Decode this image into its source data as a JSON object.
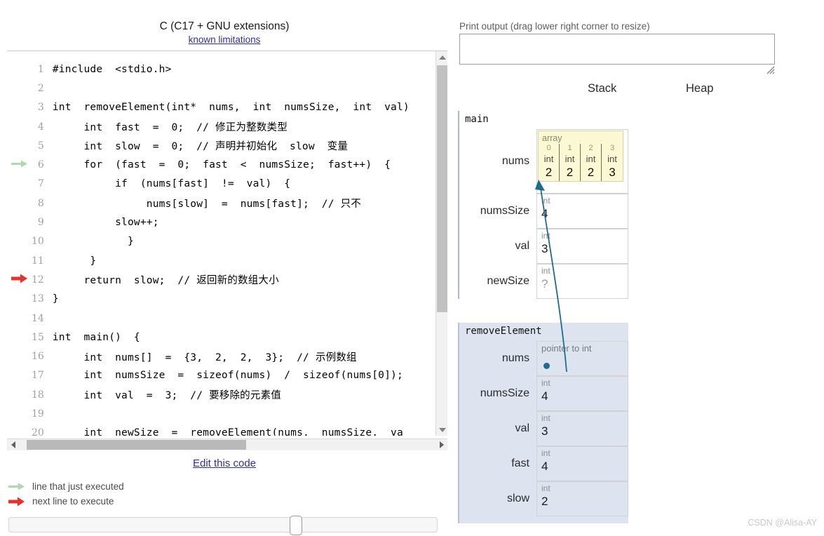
{
  "left": {
    "lang_title": "C (C17 + GNU extensions)",
    "known_limitations_link": "known limitations",
    "edit_code_link": "Edit this code",
    "code_lines": [
      {
        "n": "1",
        "text": "#include  <stdio.h>",
        "arrow": "none"
      },
      {
        "n": "2",
        "text": "",
        "arrow": "none"
      },
      {
        "n": "3",
        "text": "int  removeElement(int*  nums,  int  numsSize,  int  val)",
        "arrow": "none"
      },
      {
        "n": "4",
        "text": "     int  fast  =  0;  // 修正为整数类型",
        "arrow": "none"
      },
      {
        "n": "5",
        "text": "     int  slow  =  0;  // 声明并初始化  slow  变量",
        "arrow": "none"
      },
      {
        "n": "6",
        "text": "     for  (fast  =  0;  fast  <  numsSize;  fast++)  {",
        "arrow": "green"
      },
      {
        "n": "7",
        "text": "          if  (nums[fast]  !=  val)  {",
        "arrow": "none"
      },
      {
        "n": "8",
        "text": "               nums[slow]  =  nums[fast];  // 只不",
        "arrow": "none"
      },
      {
        "n": "9",
        "text": "          slow++;",
        "arrow": "none"
      },
      {
        "n": "10",
        "text": "            }",
        "arrow": "none"
      },
      {
        "n": "11",
        "text": "      }",
        "arrow": "none"
      },
      {
        "n": "12",
        "text": "     return  slow;  // 返回新的数组大小",
        "arrow": "red"
      },
      {
        "n": "13",
        "text": "}",
        "arrow": "none"
      },
      {
        "n": "14",
        "text": "",
        "arrow": "none"
      },
      {
        "n": "15",
        "text": "int  main()  {",
        "arrow": "none"
      },
      {
        "n": "16",
        "text": "     int  nums[]  =  {3,  2,  2,  3};  // 示例数组",
        "arrow": "none"
      },
      {
        "n": "17",
        "text": "     int  numsSize  =  sizeof(nums)  /  sizeof(nums[0]);",
        "arrow": "none"
      },
      {
        "n": "18",
        "text": "     int  val  =  3;  // 要移除的元素值",
        "arrow": "none"
      },
      {
        "n": "19",
        "text": "",
        "arrow": "none"
      },
      {
        "n": "20",
        "text": "     int  newSize  =  removeElement(nums,  numsSize,  va",
        "arrow": "none"
      }
    ],
    "legend": [
      {
        "arrow": "green",
        "label": "line that just executed"
      },
      {
        "arrow": "red",
        "label": "next line to execute"
      }
    ]
  },
  "right": {
    "print_output_label": "Print output (drag lower right corner to resize)",
    "print_output_value": "",
    "stack_label": "Stack",
    "heap_label": "Heap",
    "frames": [
      {
        "name": "main",
        "vars": [
          {
            "name": "nums",
            "kind": "array"
          },
          {
            "name": "numsSize",
            "kind": "scalar",
            "type": "int",
            "value": "4"
          },
          {
            "name": "val",
            "kind": "scalar",
            "type": "int",
            "value": "3"
          },
          {
            "name": "newSize",
            "kind": "scalar",
            "type": "int",
            "value": "?"
          }
        ]
      },
      {
        "name": "removeElement",
        "vars": [
          {
            "name": "nums",
            "kind": "pointer",
            "type": "pointer to int"
          },
          {
            "name": "numsSize",
            "kind": "scalar",
            "type": "int",
            "value": "4"
          },
          {
            "name": "val",
            "kind": "scalar",
            "type": "int",
            "value": "3"
          },
          {
            "name": "fast",
            "kind": "scalar",
            "type": "int",
            "value": "4"
          },
          {
            "name": "slow",
            "kind": "scalar",
            "type": "int",
            "value": "2"
          }
        ]
      }
    ],
    "array_object": {
      "label": "array",
      "indices": [
        "0",
        "1",
        "2",
        "3"
      ],
      "types": [
        "int",
        "int",
        "int",
        "int"
      ],
      "values": [
        "2",
        "2",
        "2",
        "3"
      ]
    }
  },
  "watermark": "CSDN @Alisa-AY",
  "colors": {
    "link": "#2f2fa8",
    "green_arrow": "#a8dcb0",
    "red_arrow": "#e8312a",
    "pointer": "#1f6b8e",
    "array_bg": "#fbf8d4",
    "frame_bg": "#dde4f0"
  }
}
